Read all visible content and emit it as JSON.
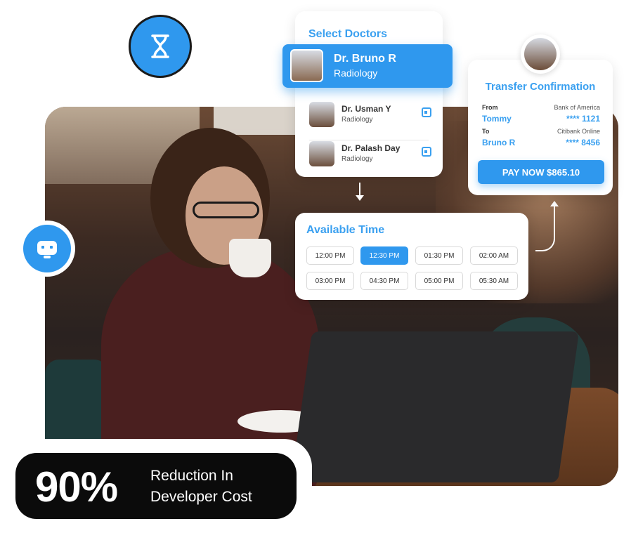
{
  "doctors": {
    "title": "Select Doctors",
    "selected": {
      "name": "Dr. Bruno R",
      "specialty": "Radiology"
    },
    "list": [
      {
        "name": "Dr. Usman Y",
        "specialty": "Radiology"
      },
      {
        "name": "Dr. Palash Day",
        "specialty": "Radiology"
      }
    ]
  },
  "times": {
    "title": "Available Time",
    "slots": [
      "12:00 PM",
      "12:30 PM",
      "01:30 PM",
      "02:00 AM",
      "03:00 PM",
      "04:30 PM",
      "05:00 PM",
      "05:30 AM"
    ],
    "active": "12:30 PM"
  },
  "transfer": {
    "title": "Transfer Confirmation",
    "from_label": "From",
    "from_name": "Tommy",
    "from_bank": "Bank of America",
    "from_account": "**** 1121",
    "to_label": "To",
    "to_name": "Bruno R",
    "to_bank": "Citibank Online",
    "to_account": "**** 8456",
    "pay_label": "PAY NOW $865.10"
  },
  "stat": {
    "value": "90%",
    "line1": "Reduction In",
    "line2": "Developer Cost"
  },
  "icons": {
    "hourglass": "hourglass-icon",
    "robot": "robot-icon",
    "calendar": "calendar-icon"
  },
  "colors": {
    "accent": "#2f98ee",
    "dark": "#0b0b0b"
  }
}
